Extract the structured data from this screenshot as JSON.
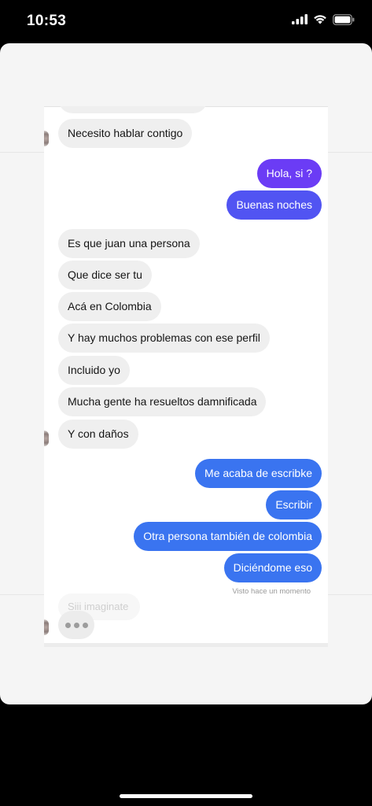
{
  "status_bar": {
    "time": "10:53",
    "icons": [
      "cellular-signal-icon",
      "wifi-icon",
      "battery-icon"
    ]
  },
  "chat": {
    "incoming_partial_top": "",
    "messages": [
      {
        "dir": "in",
        "text": "Necesito hablar contigo"
      },
      {
        "dir": "out",
        "text": "Hola, si ?",
        "color": "#6b3cf5"
      },
      {
        "dir": "out",
        "text": "Buenas noches",
        "color": "#5a46f3"
      },
      {
        "dir": "in",
        "text": "Es que juan una persona"
      },
      {
        "dir": "in",
        "text": "Que dice ser tu"
      },
      {
        "dir": "in",
        "text": "Acá en Colombia"
      },
      {
        "dir": "in",
        "text": "Y hay muchos problemas con ese perfil"
      },
      {
        "dir": "in",
        "text": "Incluido yo"
      },
      {
        "dir": "in",
        "text": "Mucha gente ha resueltos damnificada"
      },
      {
        "dir": "in",
        "text": "Y con daños"
      },
      {
        "dir": "out",
        "text": "Me acaba de escribke",
        "color": "#3a74f0"
      },
      {
        "dir": "out",
        "text": "Escribir",
        "color": "#3a74f0"
      },
      {
        "dir": "out",
        "text": "Otra persona también de colombia",
        "color": "#3a74f0"
      },
      {
        "dir": "out",
        "text": "Diciéndome eso",
        "color": "#3a74f0"
      }
    ],
    "seen_label": "Visto hace un momento",
    "faded_reply": "Siii imaginate",
    "typing_indicator": "typing-dots"
  }
}
